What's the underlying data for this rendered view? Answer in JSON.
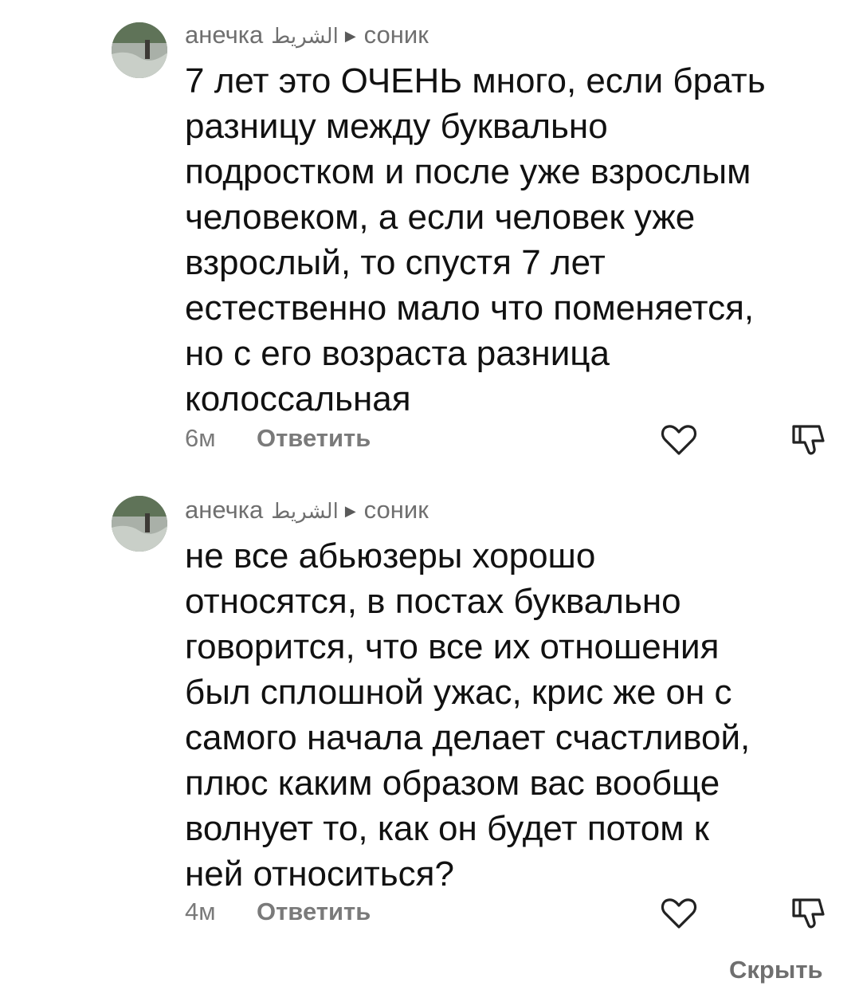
{
  "comments": [
    {
      "author": "анечка",
      "tag": "الشريط",
      "reply_to": "соник",
      "text": "7 лет это ОЧЕНЬ много, если брать\nразницу между буквально\nподростком и после уже взрослым\nчеловеком, а если человек уже\nвзрослый, то спустя 7 лет\nестественно мало что поменяется,\nно с его возраста разница\nколоссальная",
      "time": "6м",
      "reply_label": "Ответить",
      "like_icon": "heart-outline-icon",
      "dislike_icon": "thumbs-down-outline-icon"
    },
    {
      "author": "анечка",
      "tag": "الشريط",
      "reply_to": "соник",
      "text": "не все абьюзеры хорошо\nотносятся, в постах буквально\nговорится, что все их отношения\nбыл сплошной ужас, крис же он с\nсамого начала делает счастливой,\nплюс каким образом вас вообще\nволнует то, как он будет потом к\nней относиться?",
      "time": "4м",
      "reply_label": "Ответить",
      "like_icon": "heart-outline-icon",
      "dislike_icon": "thumbs-down-outline-icon"
    }
  ],
  "footer": {
    "hide_label": "Скрыть"
  },
  "colors": {
    "text": "#111111",
    "meta": "#7a7a7a",
    "icon": "#222222"
  }
}
